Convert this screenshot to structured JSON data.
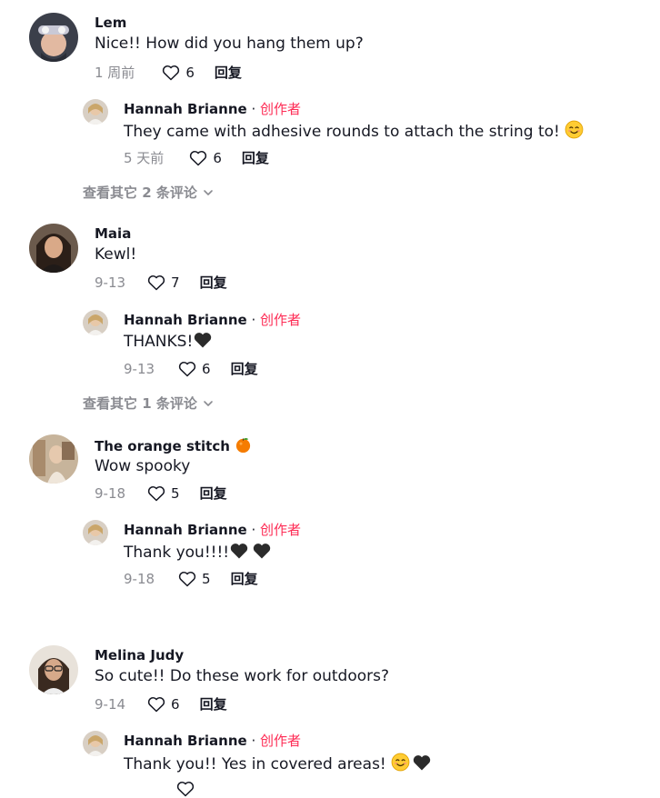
{
  "labels": {
    "reply": "回复",
    "creator": "创作者",
    "separator": " · "
  },
  "threads": [
    {
      "comment": {
        "username": "Lem",
        "text": "Nice!! How did you hang them up?",
        "date": "1 周前",
        "likes": "6"
      },
      "reply": {
        "username": "Hannah Brianne",
        "text": "They came with adhesive rounds to attach the string to!",
        "date": "5 天前",
        "likes": "6"
      },
      "view_more": "查看其它 2 条评论"
    },
    {
      "comment": {
        "username": "Maia",
        "text": "Kewl!",
        "date": "9-13",
        "likes": "7"
      },
      "reply": {
        "username": "Hannah Brianne",
        "text": "THANKS!",
        "date": "9-13",
        "likes": "6"
      },
      "view_more": "查看其它 1 条评论"
    },
    {
      "comment": {
        "username": "The orange stitch",
        "text": "Wow spooky",
        "date": "9-18",
        "likes": "5"
      },
      "reply": {
        "username": "Hannah Brianne",
        "text": "Thank you!!!!",
        "date": "9-18",
        "likes": "5"
      }
    },
    {
      "comment": {
        "username": "Melina Judy",
        "text": "So cute!! Do these work for outdoors?",
        "date": "9-14",
        "likes": "6"
      },
      "reply": {
        "username": "Hannah Brianne",
        "text": "Thank you!! Yes in covered areas!"
      }
    }
  ],
  "icons": {
    "like": "heart-outline-icon",
    "expand": "chevron-down-icon",
    "smile": "smiling-face-emoji",
    "heart": "black-heart-emoji",
    "orange": "orange-emoji"
  },
  "colors": {
    "creator": "#fe2c55",
    "muted": "#8a8b91",
    "text": "#161823"
  }
}
